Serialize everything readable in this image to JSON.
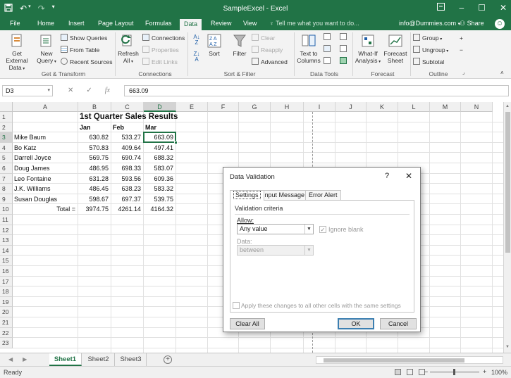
{
  "window": {
    "title": "SampleExcel - Excel",
    "qat_icons": [
      "save-icon",
      "undo-icon",
      "redo-icon",
      "customize-icon"
    ],
    "controls": [
      "ribbon-display-icon",
      "minimize-icon",
      "maximize-icon",
      "close-icon"
    ]
  },
  "tabs": [
    "File",
    "Home",
    "Insert",
    "Page Layout",
    "Formulas",
    "Data",
    "Review",
    "View"
  ],
  "active_tab": "Data",
  "tell_me": "Tell me what you want to do...",
  "user": "info@Dummies.com",
  "share": "Share",
  "ribbon": {
    "get_transform": {
      "label": "Get & Transform",
      "get_external_data": [
        "Get External",
        "Data"
      ],
      "new_query": [
        "New",
        "Query"
      ],
      "show_queries": "Show Queries",
      "from_table": "From Table",
      "recent_sources": "Recent Sources"
    },
    "connections": {
      "label": "Connections",
      "refresh_all": [
        "Refresh",
        "All"
      ],
      "connections": "Connections",
      "properties": "Properties",
      "edit_links": "Edit Links"
    },
    "sort_filter": {
      "label": "Sort & Filter",
      "sort": "Sort",
      "filter": "Filter",
      "clear": "Clear",
      "reapply": "Reapply",
      "advanced": "Advanced"
    },
    "data_tools": {
      "label": "Data Tools",
      "text_to_columns": [
        "Text to",
        "Columns"
      ]
    },
    "forecast": {
      "label": "Forecast",
      "what_if": [
        "What-If",
        "Analysis"
      ],
      "forecast_sheet": [
        "Forecast",
        "Sheet"
      ]
    },
    "outline": {
      "label": "Outline",
      "group": "Group",
      "ungroup": "Ungroup",
      "subtotal": "Subtotal"
    }
  },
  "formula_bar": {
    "name_box": "D3",
    "value": "663.09"
  },
  "columns": [
    "A",
    "B",
    "C",
    "D",
    "E",
    "F",
    "G",
    "H",
    "I",
    "J",
    "K",
    "L",
    "M",
    "N"
  ],
  "rows": [
    "1",
    "2",
    "3",
    "4",
    "5",
    "6",
    "7",
    "8",
    "9",
    "10",
    "11",
    "12",
    "13",
    "14",
    "15",
    "16",
    "17",
    "18",
    "19",
    "20",
    "21",
    "22",
    "23"
  ],
  "sheet": {
    "title": "1st Quarter Sales Results",
    "headers": [
      "Jan",
      "Feb",
      "Mar"
    ],
    "data": [
      {
        "name": "Mike Baum",
        "jan": "630.82",
        "feb": "533.27",
        "mar": "663.09"
      },
      {
        "name": "Bo Katz",
        "jan": "570.83",
        "feb": "409.64",
        "mar": "497.41"
      },
      {
        "name": "Darrell Joyce",
        "jan": "569.75",
        "feb": "690.74",
        "mar": "688.32"
      },
      {
        "name": "Doug James",
        "jan": "486.95",
        "feb": "698.33",
        "mar": "583.07"
      },
      {
        "name": "Leo Fontaine",
        "jan": "631.28",
        "feb": "593.56",
        "mar": "609.36"
      },
      {
        "name": "J.K. Williams",
        "jan": "486.45",
        "feb": "638.23",
        "mar": "583.32"
      },
      {
        "name": "Susan Douglas",
        "jan": "598.67",
        "feb": "697.37",
        "mar": "539.75"
      }
    ],
    "total": {
      "label": "Total =",
      "jan": "3974.75",
      "feb": "4261.14",
      "mar": "4164.32"
    }
  },
  "sheet_tabs": [
    "Sheet1",
    "Sheet2",
    "Sheet3"
  ],
  "active_sheet": "Sheet1",
  "status": {
    "ready": "Ready",
    "zoom": "100%"
  },
  "dialog": {
    "title": "Data Validation",
    "help": "?",
    "close": "✕",
    "tabs": [
      "Settings",
      "Input Message",
      "Error Alert"
    ],
    "section": "Validation criteria",
    "allow_label": "Allow:",
    "allow_value": "Any value",
    "ignore_blank": "Ignore blank",
    "data_label": "Data:",
    "data_value": "between",
    "apply_all": "Apply these changes to all other cells with the same settings",
    "clear_all": "Clear All",
    "ok": "OK",
    "cancel": "Cancel"
  },
  "colors": {
    "excel_green": "#217346",
    "ribbon_bg": "#f3f3f3"
  }
}
